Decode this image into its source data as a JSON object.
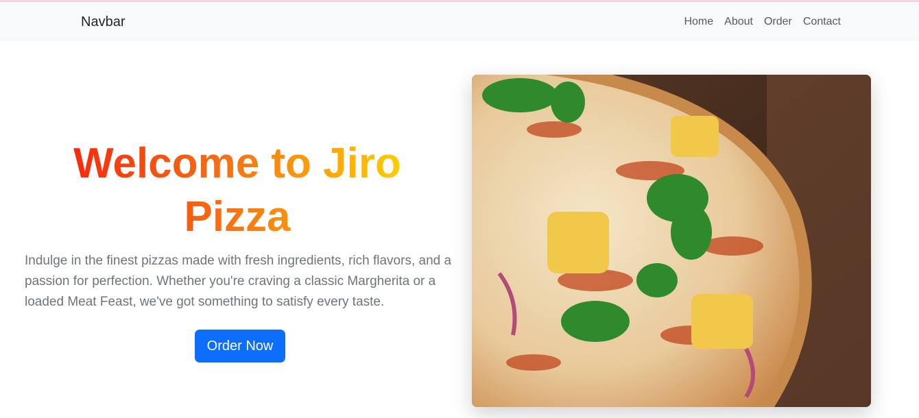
{
  "navbar": {
    "brand": "Navbar",
    "links": [
      "Home",
      "About",
      "Order",
      "Contact"
    ]
  },
  "hero": {
    "title": "Welcome to Jiro Pizza",
    "description": "Indulge in the finest pizzas made with fresh ingredients, rich flavors, and a passion for perfection. Whether you're craving a classic Margherita or a loaded Meat Feast, we've got something to satisfy every taste.",
    "button_label": "Order Now",
    "image_icon": "pizza-photo"
  },
  "colors": {
    "navbar_bg": "#f8f9fa",
    "button_bg": "#0d6efd",
    "title_gradient": [
      "#f8150a",
      "#f76b14",
      "#ffe600"
    ],
    "text": "#6c757d"
  }
}
